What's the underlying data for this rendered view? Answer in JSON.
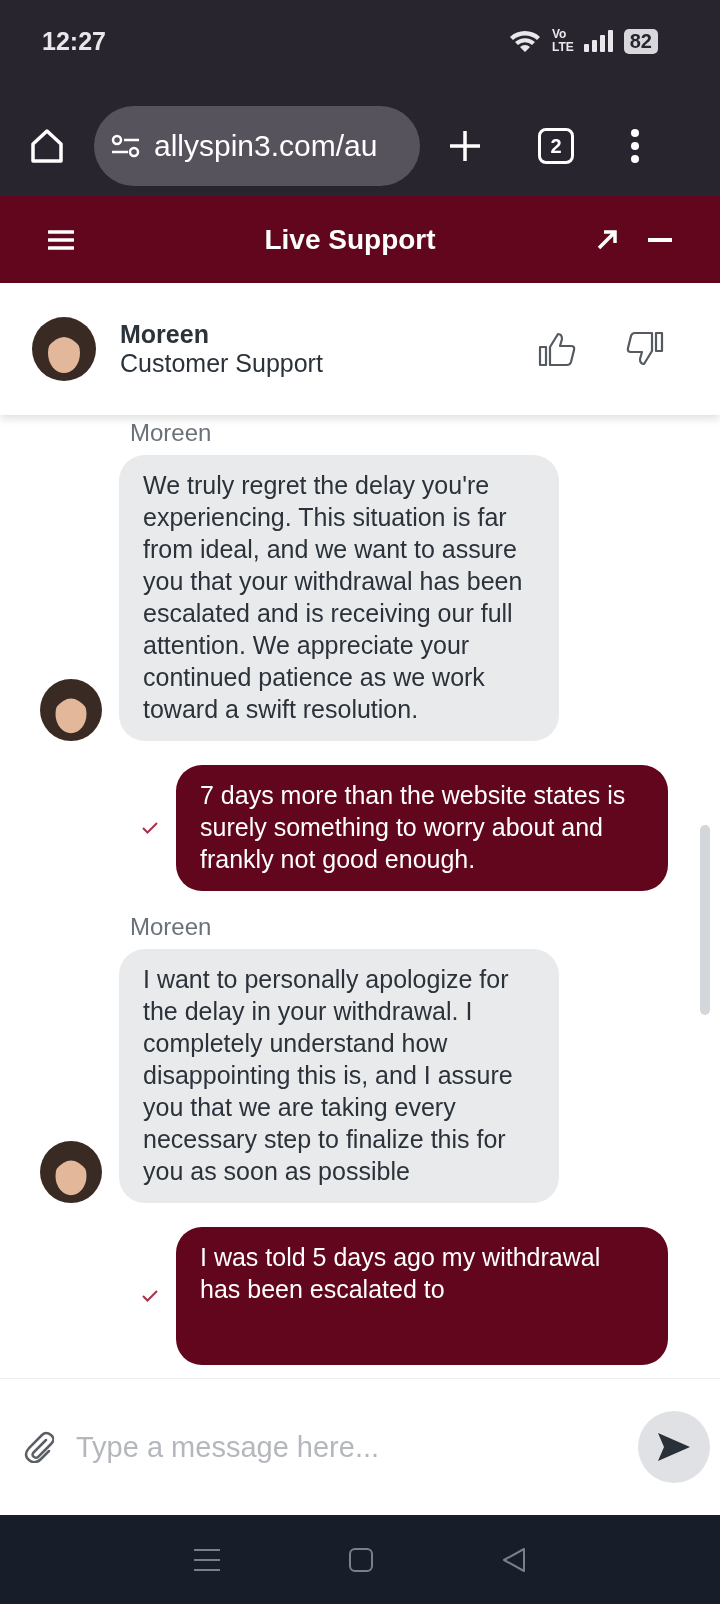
{
  "status_bar": {
    "time": "12:27",
    "network": [
      "Vo",
      "LTE"
    ],
    "battery": "82"
  },
  "browser": {
    "url": "allyspin3.com/au",
    "tab_count": "2"
  },
  "header": {
    "title": "Live Support"
  },
  "agent": {
    "name": "Moreen",
    "role": "Customer Support"
  },
  "messages": [
    {
      "kind": "agent",
      "sender": "Moreen",
      "text": "We truly regret the delay you're experiencing. This situation is far from ideal, and we want to assure you that your withdrawal has been escalated and is receiving our full attention. We appreciate your continued patience as we work toward a swift resolution."
    },
    {
      "kind": "user",
      "text": "7 days more than the website states is surely something to worry about and frankly not good enough."
    },
    {
      "kind": "agent",
      "sender": "Moreen",
      "text": "I want to personally apologize for the delay in your withdrawal. I completely understand how disappointing this is, and I assure you that we are taking every necessary step to finalize this for you as soon as possible"
    },
    {
      "kind": "user",
      "text": "I was told 5 days ago my withdrawal has been escalated to"
    }
  ],
  "composer": {
    "placeholder": "Type a message here..."
  }
}
